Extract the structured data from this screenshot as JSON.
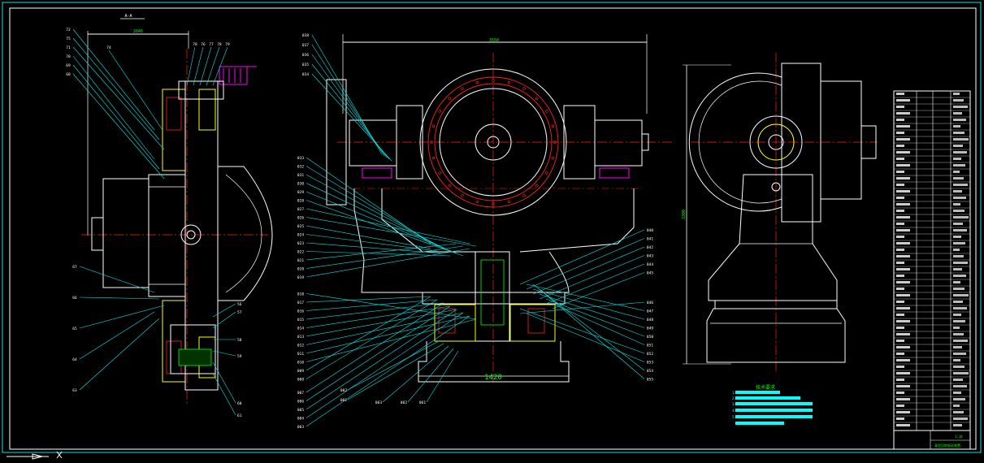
{
  "colors": {
    "background": "#000000",
    "frame": "#ffffff",
    "leader": "#00e5e5",
    "centerline": "#ff2020",
    "outline": "#ffffff",
    "hatch": "#ffff00",
    "accent_green": "#00ff00",
    "accent_magenta": "#ff00ff",
    "note_band": "#00ffff"
  },
  "left_view": {
    "top_dim": "2045",
    "section_mark": "A-A",
    "labels_left": [
      "72",
      "75",
      "71",
      "70",
      "69",
      "68",
      "67",
      "66",
      "65",
      "64",
      "63"
    ],
    "labels_top": [
      "74",
      "78",
      "76",
      "77",
      "78",
      "79"
    ],
    "labels_right": [
      "56",
      "57",
      "58",
      "59",
      "60",
      "61"
    ]
  },
  "middle_view": {
    "top_dim": "3550",
    "bottom_dim": "1420",
    "labels_top_left": [
      "038",
      "037",
      "036",
      "035",
      "034"
    ],
    "labels_left": [
      "033",
      "032",
      "031",
      "030",
      "029",
      "028",
      "027",
      "026",
      "025",
      "024",
      "023",
      "022",
      "021",
      "020",
      "019",
      "018",
      "017",
      "016",
      "015",
      "014",
      "013",
      "012",
      "011",
      "010",
      "009",
      "008",
      "007",
      "006",
      "005",
      "004",
      "003"
    ],
    "labels_right": [
      "040",
      "041",
      "042",
      "043",
      "044",
      "045",
      "046",
      "047",
      "048",
      "049",
      "050",
      "051",
      "052",
      "053",
      "054",
      "055"
    ],
    "labels_bottom": [
      "002",
      "001",
      "063",
      "062",
      "061"
    ]
  },
  "right_view": {
    "height_dim": "3300"
  },
  "notes": {
    "title": "技术要求",
    "lines": [
      "1.",
      "2.",
      "3.",
      "4.",
      "5."
    ]
  },
  "title_block": {
    "drawing_name": "某型回转驱动装置",
    "scale": "1:10"
  }
}
